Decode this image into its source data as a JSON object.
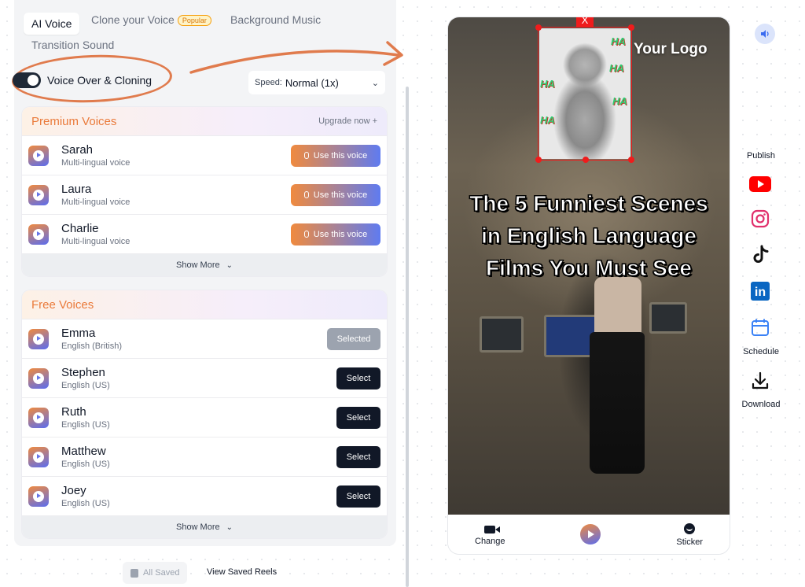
{
  "tabs": [
    {
      "label": "AI Voice",
      "active": true
    },
    {
      "label": "Clone your Voice",
      "badge": "Popular"
    },
    {
      "label": "Background Music"
    },
    {
      "label": "Transition Sound"
    }
  ],
  "voiceover": {
    "toggle_label": "Voice Over & Cloning",
    "enabled": true
  },
  "speed": {
    "label": "Speed:",
    "value": "Normal (1x)"
  },
  "premium": {
    "title": "Premium Voices",
    "upgrade": "Upgrade now +",
    "voices": [
      {
        "name": "Sarah",
        "desc": "Multi-lingual voice",
        "action": "Use this voice"
      },
      {
        "name": "Laura",
        "desc": "Multi-lingual voice",
        "action": "Use this voice"
      },
      {
        "name": "Charlie",
        "desc": "Multi-lingual voice",
        "action": "Use this voice"
      }
    ],
    "show_more": "Show More"
  },
  "free": {
    "title": "Free Voices",
    "voices": [
      {
        "name": "Emma",
        "desc": "English (British)",
        "action": "Selected"
      },
      {
        "name": "Stephen",
        "desc": "English (US)",
        "action": "Select"
      },
      {
        "name": "Ruth",
        "desc": "English (US)",
        "action": "Select"
      },
      {
        "name": "Matthew",
        "desc": "English (US)",
        "action": "Select"
      },
      {
        "name": "Joey",
        "desc": "English (US)",
        "action": "Select"
      }
    ],
    "show_more": "Show More"
  },
  "footer": {
    "saved": "All Saved",
    "view_saved": "View Saved Reels"
  },
  "preview": {
    "logo": "Your Logo",
    "caption": "The 5 Funniest Scenes in English Language Films You Must See",
    "ha_text": "HA",
    "close": "X",
    "bar": {
      "change": "Change",
      "sticker": "Sticker"
    }
  },
  "rail": {
    "publish": "Publish",
    "schedule": "Schedule",
    "download": "Download",
    "linkedin_text": "in"
  },
  "colors": {
    "accent_orange": "#f08a3e",
    "accent_blue": "#5f7bf0",
    "youtube": "#ff0000",
    "instagram": "#e1306c",
    "linkedin": "#0a66c2",
    "schedule": "#3b82f6"
  }
}
